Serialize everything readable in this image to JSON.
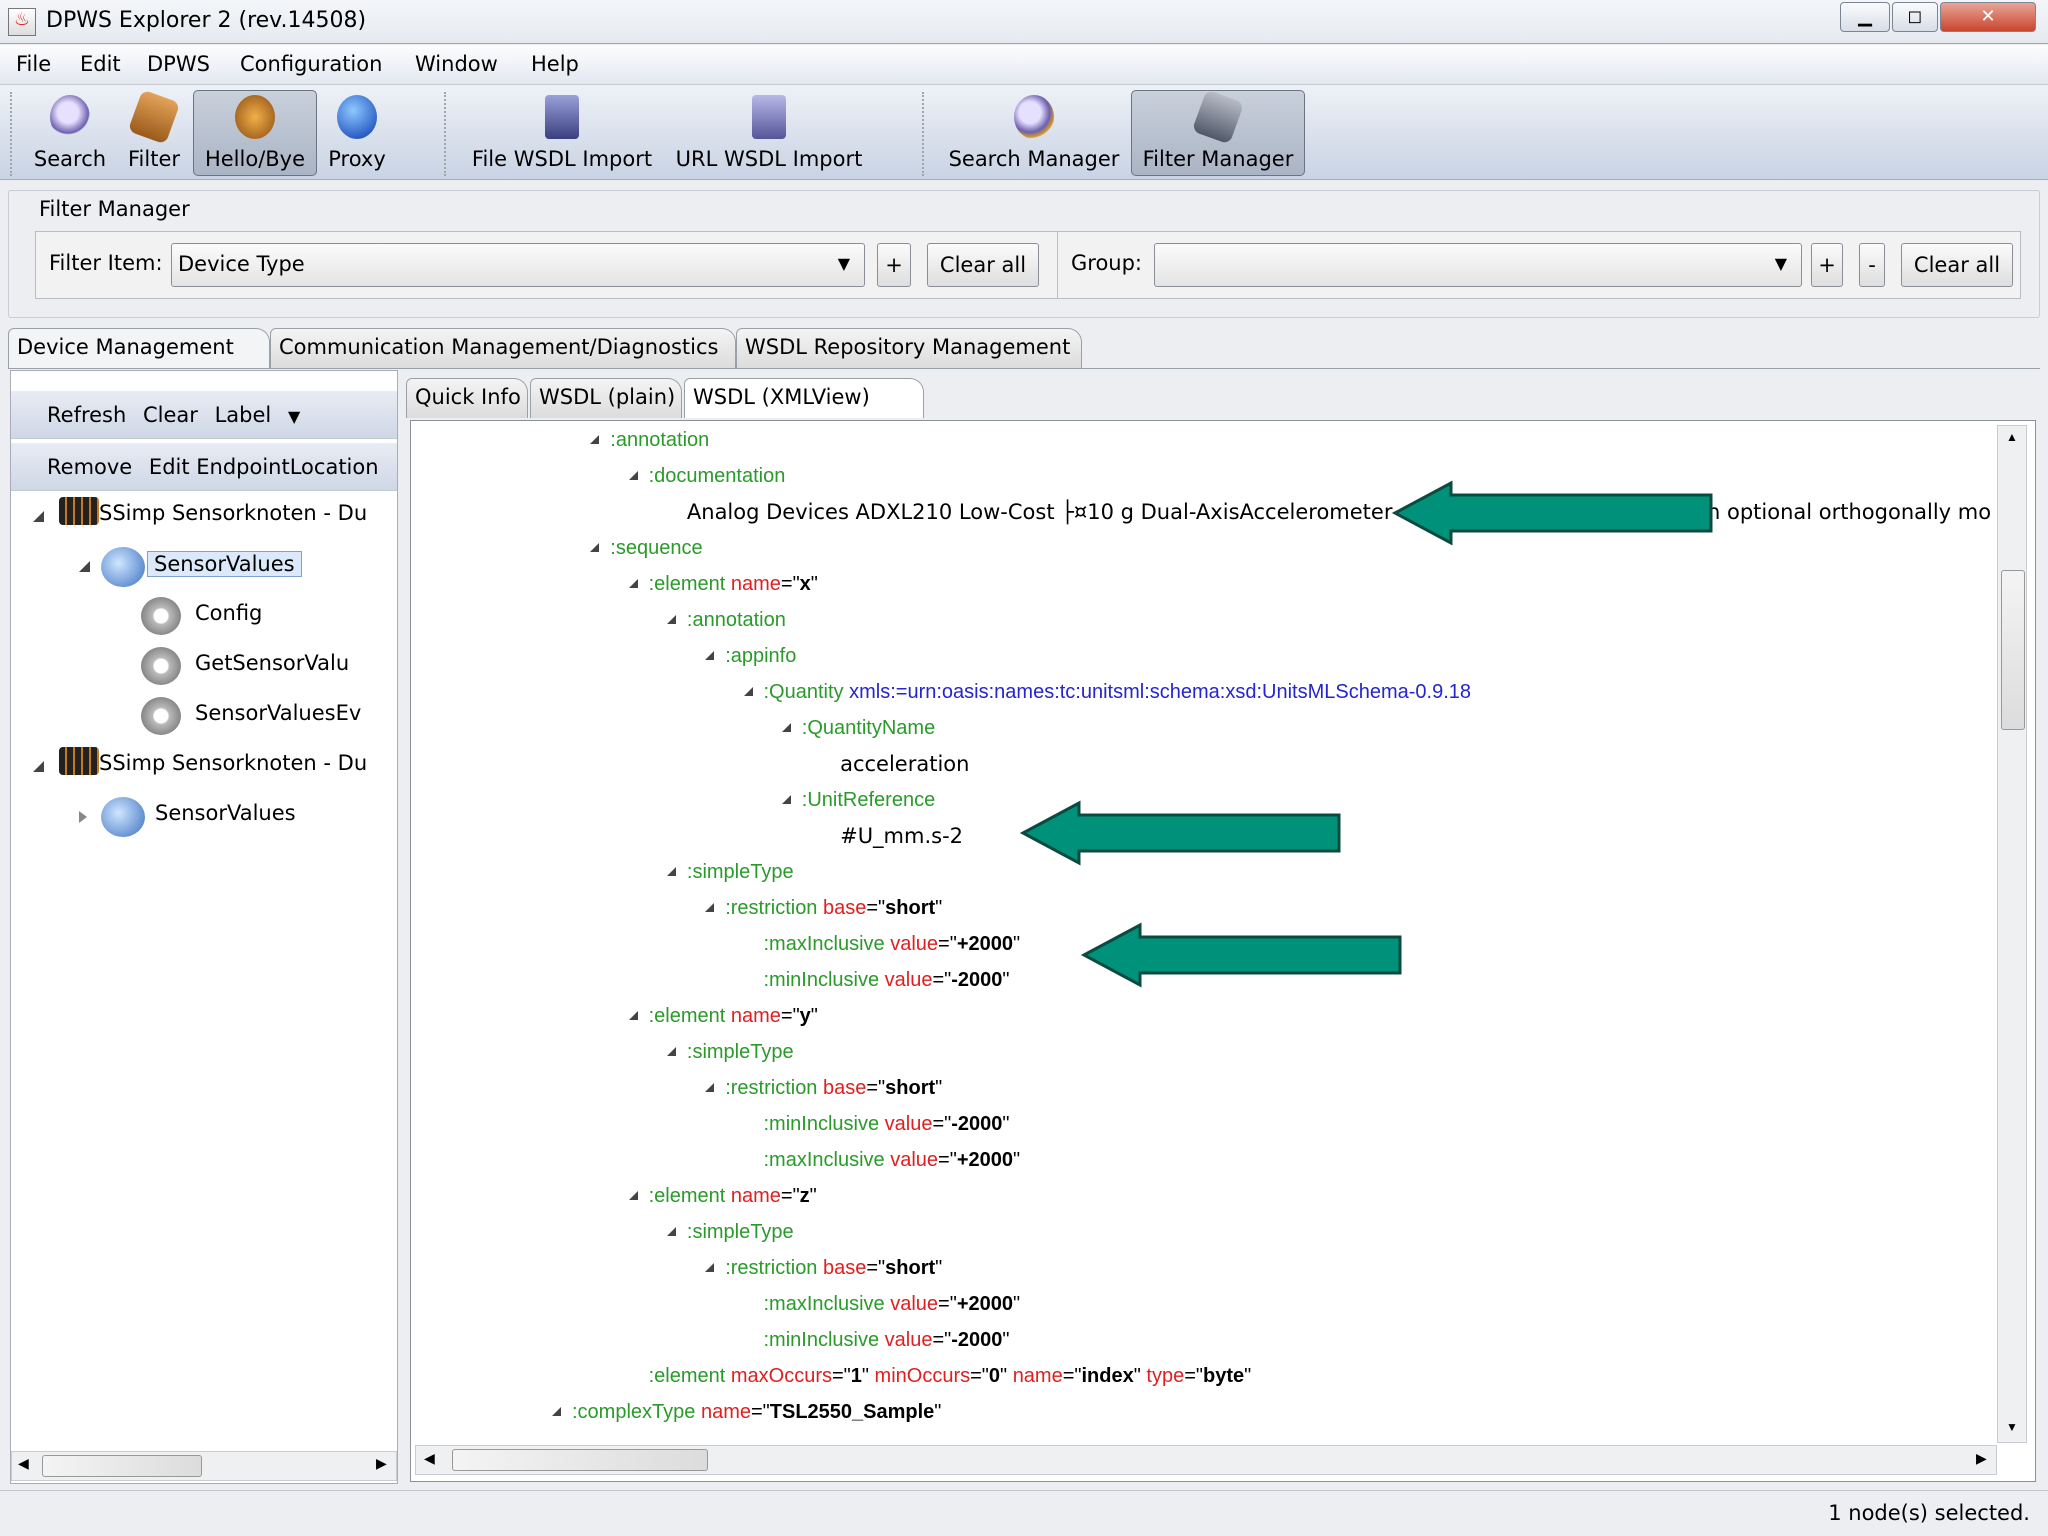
{
  "window": {
    "title": "DPWS Explorer 2 (rev.14508)",
    "minimize": "▁",
    "maximize": "◻",
    "close": "✕"
  },
  "menu": [
    "File",
    "Edit",
    "DPWS",
    "Configuration",
    "Window",
    "Help"
  ],
  "toolbar": [
    {
      "label": "Search",
      "icon": "magnifier-icon",
      "pressed": false
    },
    {
      "label": "Filter",
      "icon": "filter-book-icon",
      "pressed": false
    },
    {
      "label": "Hello/Bye",
      "icon": "hello-bye-icon",
      "pressed": true
    },
    {
      "label": "Proxy",
      "icon": "globe-icon",
      "pressed": false
    },
    {
      "label": "File WSDL Import",
      "icon": "file-import-icon",
      "pressed": false
    },
    {
      "label": "URL WSDL Import",
      "icon": "url-import-icon",
      "pressed": false
    },
    {
      "label": "Search Manager",
      "icon": "search-manager-icon",
      "pressed": false
    },
    {
      "label": "Filter Manager",
      "icon": "filter-manager-icon",
      "pressed": true
    }
  ],
  "filter_manager": {
    "title": "Filter Manager",
    "filter_item_label": "Filter Item:",
    "filter_item_value": "Device Type",
    "plus": "+",
    "minus": "-",
    "clear_all": "Clear all",
    "group_label": "Group:",
    "group_value": ""
  },
  "main_tabs": [
    "Device Management",
    "Communication Management/Diagnostics",
    "WSDL Repository Management"
  ],
  "left": {
    "toolbar1": [
      "Refresh",
      "Clear",
      "Label"
    ],
    "label_arrow": "▼",
    "toolbar2": [
      "Remove",
      "Edit EndpointLocation"
    ],
    "tree": [
      {
        "label": "SSimp Sensorknoten - Du",
        "type": "device",
        "depth": 0,
        "expanded": true
      },
      {
        "label": "SensorValues",
        "type": "service",
        "depth": 1,
        "expanded": true,
        "selected": true
      },
      {
        "label": "Config",
        "type": "operation",
        "depth": 2
      },
      {
        "label": "GetSensorValu",
        "type": "operation",
        "depth": 2
      },
      {
        "label": "SensorValuesEv",
        "type": "event",
        "depth": 2
      },
      {
        "label": "SSimp Sensorknoten - Du",
        "type": "device",
        "depth": 0,
        "expanded": true
      },
      {
        "label": "SensorValues",
        "type": "service",
        "depth": 1,
        "expanded": false
      }
    ]
  },
  "sub_tabs": [
    "Quick Info",
    "WSDL (plain)",
    "WSDL (XMLView)"
  ],
  "xml_rows": [
    {
      "d": 1,
      "tri": true,
      "parts": [
        [
          ":annotation",
          "g"
        ]
      ]
    },
    {
      "d": 2,
      "tri": true,
      "parts": [
        [
          ":documentation",
          "g"
        ]
      ]
    },
    {
      "d": 3,
      "tri": false,
      "parts": [
        [
          "Analog Devices ADXL210 Low-Cost ├¤10 g Dual-AxisAccelerometer",
          "plain"
        ]
      ],
      "tail": "n optional orthogonally mo"
    },
    {
      "d": 1,
      "tri": true,
      "parts": [
        [
          ":sequence",
          "g"
        ]
      ]
    },
    {
      "d": 2,
      "tri": true,
      "parts": [
        [
          ":element ",
          "g"
        ],
        [
          "name",
          "r"
        ],
        [
          "=\"",
          "k"
        ],
        [
          "x",
          "k b"
        ],
        [
          "\"",
          "k"
        ]
      ]
    },
    {
      "d": 3,
      "tri": true,
      "parts": [
        [
          ":annotation",
          "g"
        ]
      ]
    },
    {
      "d": 4,
      "tri": true,
      "parts": [
        [
          ":appinfo",
          "g"
        ]
      ]
    },
    {
      "d": 5,
      "tri": true,
      "parts": [
        [
          ":Quantity ",
          "g"
        ],
        [
          "xmls:=urn:oasis:names:tc:unitsml:schema:xsd:UnitsMLSchema-0.9.18",
          "bl"
        ]
      ]
    },
    {
      "d": 6,
      "tri": true,
      "parts": [
        [
          ":QuantityName",
          "g"
        ]
      ]
    },
    {
      "d": 7,
      "tri": false,
      "parts": [
        [
          "acceleration",
          "plain"
        ]
      ]
    },
    {
      "d": 6,
      "tri": true,
      "parts": [
        [
          ":UnitReference",
          "g"
        ]
      ]
    },
    {
      "d": 7,
      "tri": false,
      "parts": [
        [
          "#U_mm.s-2",
          "plain"
        ]
      ]
    },
    {
      "d": 3,
      "tri": true,
      "parts": [
        [
          ":simpleType",
          "g"
        ]
      ]
    },
    {
      "d": 4,
      "tri": true,
      "parts": [
        [
          ":restriction ",
          "g"
        ],
        [
          "base",
          "r"
        ],
        [
          "=\"",
          "k"
        ],
        [
          "short",
          "k b"
        ],
        [
          "\"",
          "k"
        ]
      ]
    },
    {
      "d": 5,
      "tri": false,
      "parts": [
        [
          ":maxInclusive ",
          "g"
        ],
        [
          "value",
          "r"
        ],
        [
          "=\"",
          "k"
        ],
        [
          "+2000",
          "k b"
        ],
        [
          "\"",
          "k"
        ]
      ]
    },
    {
      "d": 5,
      "tri": false,
      "parts": [
        [
          ":minInclusive ",
          "g"
        ],
        [
          "value",
          "r"
        ],
        [
          "=\"",
          "k"
        ],
        [
          "-2000",
          "k b"
        ],
        [
          "\"",
          "k"
        ]
      ]
    },
    {
      "d": 2,
      "tri": true,
      "parts": [
        [
          ":element ",
          "g"
        ],
        [
          "name",
          "r"
        ],
        [
          "=\"",
          "k"
        ],
        [
          "y",
          "k b"
        ],
        [
          "\"",
          "k"
        ]
      ]
    },
    {
      "d": 3,
      "tri": true,
      "parts": [
        [
          ":simpleType",
          "g"
        ]
      ]
    },
    {
      "d": 4,
      "tri": true,
      "parts": [
        [
          ":restriction ",
          "g"
        ],
        [
          "base",
          "r"
        ],
        [
          "=\"",
          "k"
        ],
        [
          "short",
          "k b"
        ],
        [
          "\"",
          "k"
        ]
      ]
    },
    {
      "d": 5,
      "tri": false,
      "parts": [
        [
          ":minInclusive ",
          "g"
        ],
        [
          "value",
          "r"
        ],
        [
          "=\"",
          "k"
        ],
        [
          "-2000",
          "k b"
        ],
        [
          "\"",
          "k"
        ]
      ]
    },
    {
      "d": 5,
      "tri": false,
      "parts": [
        [
          ":maxInclusive ",
          "g"
        ],
        [
          "value",
          "r"
        ],
        [
          "=\"",
          "k"
        ],
        [
          "+2000",
          "k b"
        ],
        [
          "\"",
          "k"
        ]
      ]
    },
    {
      "d": 2,
      "tri": true,
      "parts": [
        [
          ":element ",
          "g"
        ],
        [
          "name",
          "r"
        ],
        [
          "=\"",
          "k"
        ],
        [
          "z",
          "k b"
        ],
        [
          "\"",
          "k"
        ]
      ]
    },
    {
      "d": 3,
      "tri": true,
      "parts": [
        [
          ":simpleType",
          "g"
        ]
      ]
    },
    {
      "d": 4,
      "tri": true,
      "parts": [
        [
          ":restriction ",
          "g"
        ],
        [
          "base",
          "r"
        ],
        [
          "=\"",
          "k"
        ],
        [
          "short",
          "k b"
        ],
        [
          "\"",
          "k"
        ]
      ]
    },
    {
      "d": 5,
      "tri": false,
      "parts": [
        [
          ":maxInclusive ",
          "g"
        ],
        [
          "value",
          "r"
        ],
        [
          "=\"",
          "k"
        ],
        [
          "+2000",
          "k b"
        ],
        [
          "\"",
          "k"
        ]
      ]
    },
    {
      "d": 5,
      "tri": false,
      "parts": [
        [
          ":minInclusive ",
          "g"
        ],
        [
          "value",
          "r"
        ],
        [
          "=\"",
          "k"
        ],
        [
          "-2000",
          "k b"
        ],
        [
          "\"",
          "k"
        ]
      ]
    },
    {
      "d": 2,
      "tri": false,
      "parts": [
        [
          ":element ",
          "g"
        ],
        [
          "maxOccurs",
          "r"
        ],
        [
          "=\"",
          "k"
        ],
        [
          "1",
          "k b"
        ],
        [
          "\" ",
          "k"
        ],
        [
          "minOccurs",
          "r"
        ],
        [
          "=\"",
          "k"
        ],
        [
          "0",
          "k b"
        ],
        [
          "\" ",
          "k"
        ],
        [
          "name",
          "r"
        ],
        [
          "=\"",
          "k"
        ],
        [
          "index",
          "k b"
        ],
        [
          "\" ",
          "k"
        ],
        [
          "type",
          "r"
        ],
        [
          "=\"",
          "k"
        ],
        [
          "byte",
          "k b"
        ],
        [
          "\"",
          "k"
        ]
      ]
    },
    {
      "d": 0,
      "tri": true,
      "parts": [
        [
          ":complexType ",
          "g"
        ],
        [
          "name",
          "r"
        ],
        [
          "=\"",
          "k"
        ],
        [
          "TSL2550_Sample",
          "k b"
        ],
        [
          "\"",
          "k"
        ]
      ]
    }
  ],
  "status": "1 node(s) selected.",
  "colors": {
    "arrow": "#00917a",
    "arrow_outline": "#0b4b3f",
    "tag": "#2a9a2a",
    "attr": "#e02020",
    "ns": "#2424d0"
  }
}
